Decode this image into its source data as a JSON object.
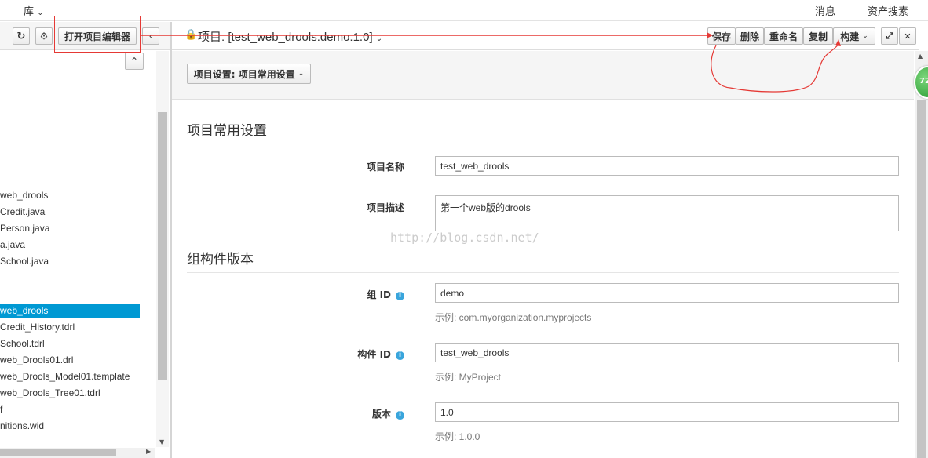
{
  "topbar": {
    "menu_repo": "库",
    "messages": "消息",
    "asset_search": "资产搜素"
  },
  "left_toolbar": {
    "open_editor_label": "打开项目编辑器"
  },
  "tree": {
    "items": [
      "web_drools",
      "Credit.java",
      "Person.java",
      "a.java",
      "School.java",
      "web_drools",
      "Credit_History.tdrl",
      "School.tdrl",
      "web_Drools01.drl",
      "web_Drools_Model01.template",
      "web_Drools_Tree01.tdrl",
      "f",
      "nitions.wid"
    ],
    "selected_index": 5
  },
  "header": {
    "title": "项目: [test_web_drools:demo:1.0]",
    "buttons": {
      "save": "保存",
      "delete": "删除",
      "rename": "重命名",
      "copy": "复制",
      "build": "构建"
    }
  },
  "subheader": {
    "settings_dropdown": "项目设置: 项目常用设置"
  },
  "form": {
    "section_general": "项目常用设置",
    "project_name_label": "项目名称",
    "project_name_value": "test_web_drools",
    "project_desc_label": "项目描述",
    "project_desc_value": "第一个web版的drools",
    "section_gav": "组构件版本",
    "group_id_label": "组 ID",
    "group_id_value": "demo",
    "group_id_help": "示例: com.myorganization.myprojects",
    "artifact_id_label": "构件 ID",
    "artifact_id_value": "test_web_drools",
    "artifact_id_help": "示例: MyProject",
    "version_label": "版本",
    "version_value": "1.0",
    "version_help": "示例: 1.0.0"
  },
  "watermark": "http://blog.csdn.net/",
  "badge": "72",
  "colors": {
    "selected": "#0099d3",
    "annotation": "#e53935",
    "info": "#39a5dc"
  }
}
